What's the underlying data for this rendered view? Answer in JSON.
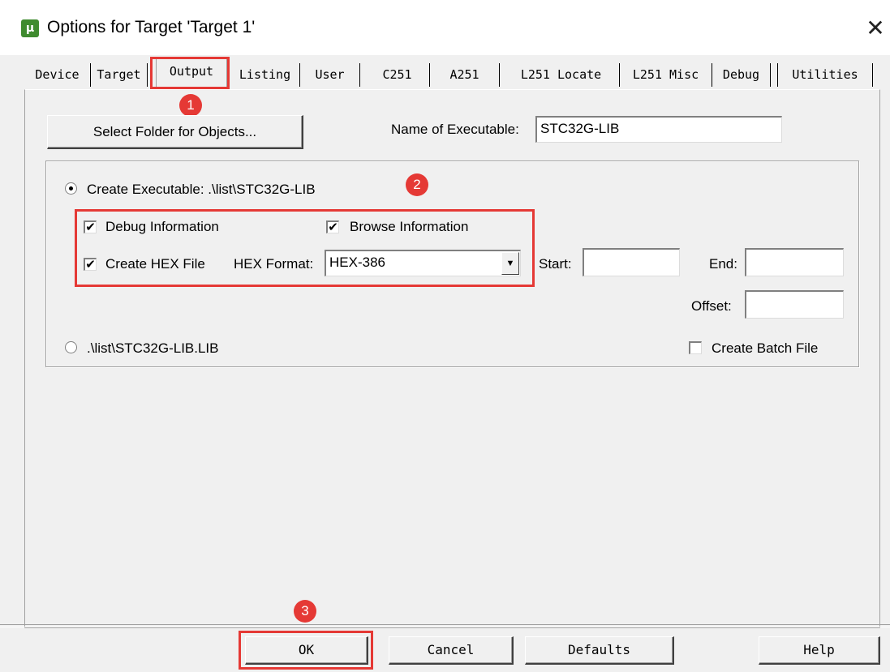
{
  "window": {
    "title": "Options for Target 'Target 1'",
    "close_glyph": "✕"
  },
  "tabs": [
    "Device",
    "Target",
    "Output",
    "Listing",
    "User",
    "C251",
    "A251",
    "L251 Locate",
    "L251 Misc",
    "Debug",
    "Utilities"
  ],
  "active_tab": "Output",
  "output": {
    "select_folder_label": "Select Folder for Objects...",
    "name_exe_label": "Name of Executable:",
    "name_exe_value": "STC32G-LIB",
    "create_exe_label": "Create Executable:  .\\list\\STC32G-LIB",
    "debug_info_label": "Debug Information",
    "browse_info_label": "Browse Information",
    "create_hex_label": "Create HEX File",
    "hex_format_label": "HEX Format:",
    "hex_format_value": "HEX-386",
    "start_label": "Start:",
    "end_label": "End:",
    "offset_label": "Offset:",
    "lib_label": ".\\list\\STC32G-LIB.LIB",
    "batch_label": "Create Batch File",
    "debug_checked": true,
    "browse_checked": true,
    "hex_checked": true,
    "batch_checked": false
  },
  "buttons": {
    "ok": "OK",
    "cancel": "Cancel",
    "defaults": "Defaults",
    "help": "Help"
  },
  "annotations": {
    "one": "1",
    "two": "2",
    "three": "3",
    "color": "#e53935"
  },
  "check_glyph": "✔"
}
